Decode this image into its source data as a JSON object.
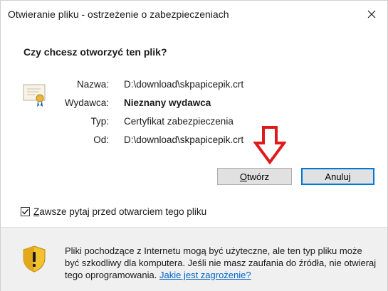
{
  "window": {
    "title": "Otwieranie pliku - ostrzeżenie o zabezpieczeniach",
    "close_glyph": "×"
  },
  "dialog": {
    "question": "Czy chcesz otworzyć ten plik?",
    "icon": "certificate-icon",
    "fields": {
      "name_label": "Nazwa:",
      "name_value": "D:\\download\\skpapicepik.crt",
      "publisher_label": "Wydawca:",
      "publisher_value": "Nieznany wydawca",
      "type_label": "Typ:",
      "type_value": "Certyfikat zabezpieczenia",
      "from_label": "Od:",
      "from_value": "D:\\download\\skpapicepik.crt"
    },
    "annotation_arrow_color": "#e0191b"
  },
  "buttons": {
    "open_accel": "O",
    "open_rest": "twórz",
    "cancel_label": "Anuluj"
  },
  "checkbox": {
    "checked": true,
    "label_accel": "Z",
    "label_rest": "awsze pytaj przed otwarciem tego pliku"
  },
  "footer": {
    "icon": "shield-warning-icon",
    "warning_text": "Pliki pochodzące z Internetu mogą być użyteczne, ale ten typ pliku może być szkodliwy dla komputera. Jeśli nie masz zaufania do źródła, nie otwieraj tego oprogramowania.",
    "link_text": "Jakie jest zagrożenie?",
    "link_color": "#0066cc"
  }
}
